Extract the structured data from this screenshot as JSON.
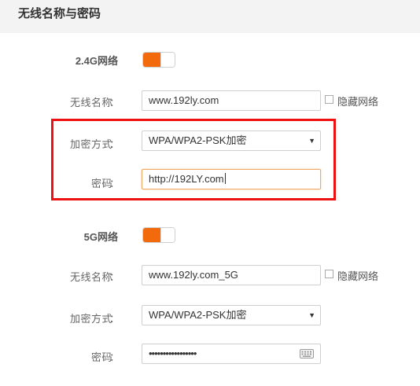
{
  "page": {
    "title": "无线名称与密码"
  },
  "band_24": {
    "section_label": "2.4G网络",
    "enabled": true,
    "ssid_label": "无线名称",
    "ssid_value": "www.192ly.com",
    "hide_label": "隐藏网络",
    "hide_checked": false,
    "security_label": "加密方式",
    "security_value": "WPA/WPA2-PSK加密",
    "password_label": "密码",
    "password_value": "http://192LY.com"
  },
  "band_5": {
    "section_label": "5G网络",
    "enabled": true,
    "ssid_label": "无线名称",
    "ssid_value": "www.192ly.com_5G",
    "hide_label": "隐藏网络",
    "hide_checked": false,
    "security_label": "加密方式",
    "security_value": "WPA/WPA2-PSK加密",
    "password_label": "密码",
    "password_masked": "•••••••••••••••••"
  },
  "labels": {
    "colon": "："
  },
  "colors": {
    "accent": "#f26a0b",
    "highlight_border": "#e11111",
    "header_bg": "#f3f3f3"
  },
  "icons": {
    "select_arrow": "▼",
    "keyboard": "keyboard-icon"
  }
}
